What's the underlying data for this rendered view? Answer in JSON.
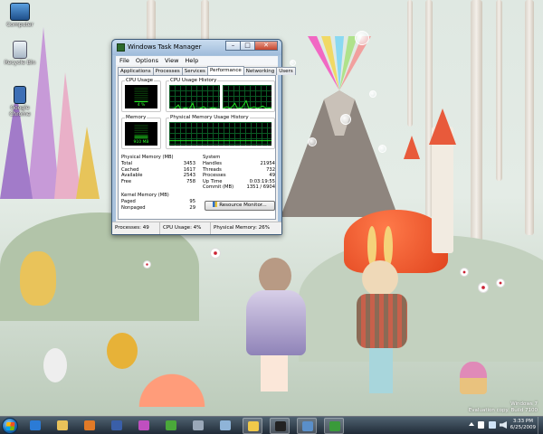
{
  "desktop": {
    "icons": [
      {
        "label": "Computer"
      },
      {
        "label": "Recycle Bin"
      },
      {
        "label": "Google Chrome"
      }
    ],
    "watermark": {
      "line1": "Windows 7",
      "line2": "Evaluation copy. Build 7100"
    }
  },
  "window": {
    "title": "Windows Task Manager",
    "controls": {
      "minimize": "–",
      "maximize": "□",
      "close": "✕"
    },
    "menu": [
      "File",
      "Options",
      "View",
      "Help"
    ],
    "tabs": [
      "Applications",
      "Processes",
      "Services",
      "Performance",
      "Networking",
      "Users"
    ],
    "active_tab": "Performance",
    "groups": {
      "cpu_usage": "CPU Usage",
      "cpu_history": "CPU Usage History",
      "memory": "Memory",
      "memory_history": "Physical Memory Usage History",
      "physical_memory": "Physical Memory (MB)",
      "system": "System",
      "kernel_memory": "Kernel Memory (MB)"
    },
    "cpu_meter": {
      "text": "4 %",
      "level": 0.04
    },
    "memory_meter": {
      "text": "910 MB",
      "level": 0.26
    },
    "physical_memory": [
      {
        "label": "Total",
        "value": "3453"
      },
      {
        "label": "Cached",
        "value": "1617"
      },
      {
        "label": "Available",
        "value": "2543"
      },
      {
        "label": "Free",
        "value": "758"
      }
    ],
    "system": [
      {
        "label": "Handles",
        "value": "21954"
      },
      {
        "label": "Threads",
        "value": "732"
      },
      {
        "label": "Processes",
        "value": "49"
      },
      {
        "label": "Up Time",
        "value": "0:03:19:55"
      },
      {
        "label": "Commit (MB)",
        "value": "1351 / 6904"
      }
    ],
    "kernel_memory": [
      {
        "label": "Paged",
        "value": "95"
      },
      {
        "label": "Nonpaged",
        "value": "29"
      }
    ],
    "resource_monitor_button": "Resource Monitor...",
    "status": {
      "processes": "Processes: 49",
      "cpu": "CPU Usage: 4%",
      "memory": "Physical Memory: 26%"
    }
  },
  "taskbar": {
    "pinned": [
      {
        "name": "ie-icon",
        "color": "#2b7bd6"
      },
      {
        "name": "explorer-icon",
        "color": "#e9c25a"
      },
      {
        "name": "media-player-icon",
        "color": "#e27a27"
      },
      {
        "name": "movie-maker-icon",
        "color": "#3a5fa8"
      },
      {
        "name": "paint-icon",
        "color": "#c04fc0"
      },
      {
        "name": "xbox-icon",
        "color": "#4aa83a"
      },
      {
        "name": "devices-icon",
        "color": "#9aa8b8"
      },
      {
        "name": "connect-icon",
        "color": "#8fb4d8"
      },
      {
        "name": "folder-icon",
        "color": "#f0c94a"
      },
      {
        "name": "cmd-icon",
        "color": "#222222"
      },
      {
        "name": "network-icon",
        "color": "#5a8fc9"
      },
      {
        "name": "task-manager-icon",
        "color": "#3a9a3a"
      }
    ],
    "clock": {
      "time": "3:33 PM",
      "date": "6/25/2009"
    }
  },
  "colors": {
    "graph_green": "#22e622",
    "graph_grid": "#0a5a24",
    "titlebar": "#a9c2dc"
  }
}
